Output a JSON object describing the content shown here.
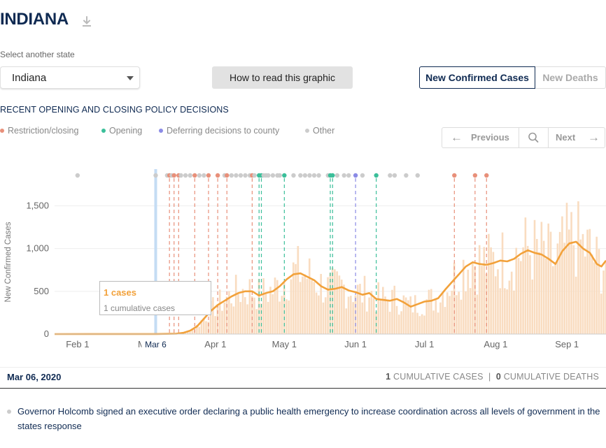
{
  "header": {
    "title": "INDIANA",
    "download_icon": "download-icon"
  },
  "selector": {
    "label": "Select another state",
    "value": "Indiana"
  },
  "buttons": {
    "how_to_read": "How to read this graphic",
    "toggle_cases": "New Confirmed Cases",
    "toggle_deaths": "New Deaths"
  },
  "policy": {
    "heading": "RECENT OPENING AND CLOSING POLICY DECISIONS",
    "legend": [
      {
        "label": "Restriction/closing",
        "color": "#e8907a"
      },
      {
        "label": "Opening",
        "color": "#3bbf9a"
      },
      {
        "label": "Deferring decisions to county",
        "color": "#8b8be6"
      },
      {
        "label": "Other",
        "color": "#cccccc"
      }
    ]
  },
  "nav": {
    "previous": "Previous",
    "next": "Next",
    "search_icon": "search-icon",
    "prev_icon": "arrow-left-icon",
    "next_icon": "arrow-right-icon"
  },
  "colors": {
    "navy": "#0f2a52",
    "line": "#f2a13a",
    "bar": "#f9dcc0",
    "selected": "#c4dcf4"
  },
  "chart_data": {
    "type": "line",
    "ylabel": "New Confirmed Cases",
    "yticks": [
      "0",
      "500",
      "1,000",
      "1,500"
    ],
    "ylim": [
      0,
      1700
    ],
    "xticks": [
      "Feb 1",
      "Ma",
      "Apr 1",
      "May 1",
      "Jun 1",
      "Jul 1",
      "Aug 1",
      "Sep 1"
    ],
    "selected_tick": "Mar 6",
    "x_range": [
      "2020-01-22",
      "2020-09-18"
    ],
    "series": [
      {
        "values_7day_avg": [
          [
            "2020-01-22",
            0
          ],
          [
            "2020-03-06",
            1
          ],
          [
            "2020-03-15",
            5
          ],
          [
            "2020-03-18",
            15
          ],
          [
            "2020-03-21",
            40
          ],
          [
            "2020-03-24",
            90
          ],
          [
            "2020-03-27",
            180
          ],
          [
            "2020-03-30",
            270
          ],
          [
            "2020-04-02",
            340
          ],
          [
            "2020-04-05",
            390
          ],
          [
            "2020-04-08",
            440
          ],
          [
            "2020-04-11",
            480
          ],
          [
            "2020-04-14",
            500
          ],
          [
            "2020-04-17",
            500
          ],
          [
            "2020-04-20",
            450
          ],
          [
            "2020-04-23",
            480
          ],
          [
            "2020-04-26",
            500
          ],
          [
            "2020-04-29",
            560
          ],
          [
            "2020-05-02",
            640
          ],
          [
            "2020-05-05",
            700
          ],
          [
            "2020-05-08",
            710
          ],
          [
            "2020-05-11",
            670
          ],
          [
            "2020-05-14",
            630
          ],
          [
            "2020-05-17",
            560
          ],
          [
            "2020-05-20",
            520
          ],
          [
            "2020-05-23",
            530
          ],
          [
            "2020-05-26",
            550
          ],
          [
            "2020-05-29",
            510
          ],
          [
            "2020-06-01",
            490
          ],
          [
            "2020-06-04",
            460
          ],
          [
            "2020-06-07",
            480
          ],
          [
            "2020-06-10",
            410
          ],
          [
            "2020-06-13",
            400
          ],
          [
            "2020-06-16",
            390
          ],
          [
            "2020-06-19",
            410
          ],
          [
            "2020-06-22",
            370
          ],
          [
            "2020-06-25",
            320
          ],
          [
            "2020-06-28",
            350
          ],
          [
            "2020-07-01",
            380
          ],
          [
            "2020-07-04",
            390
          ],
          [
            "2020-07-07",
            420
          ],
          [
            "2020-07-10",
            520
          ],
          [
            "2020-07-13",
            610
          ],
          [
            "2020-07-16",
            700
          ],
          [
            "2020-07-19",
            790
          ],
          [
            "2020-07-22",
            840
          ],
          [
            "2020-07-25",
            820
          ],
          [
            "2020-07-28",
            810
          ],
          [
            "2020-07-31",
            830
          ],
          [
            "2020-08-03",
            860
          ],
          [
            "2020-08-06",
            850
          ],
          [
            "2020-08-09",
            880
          ],
          [
            "2020-08-12",
            940
          ],
          [
            "2020-08-15",
            980
          ],
          [
            "2020-08-18",
            950
          ],
          [
            "2020-08-21",
            930
          ],
          [
            "2020-08-24",
            880
          ],
          [
            "2020-08-27",
            820
          ],
          [
            "2020-08-30",
            970
          ],
          [
            "2020-09-02",
            1060
          ],
          [
            "2020-09-05",
            1080
          ],
          [
            "2020-09-08",
            1000
          ],
          [
            "2020-09-11",
            950
          ],
          [
            "2020-09-14",
            820
          ],
          [
            "2020-09-16",
            790
          ],
          [
            "2020-09-18",
            860
          ]
        ]
      }
    ],
    "policy_events": [
      {
        "date": "2020-02-01",
        "type": "other"
      },
      {
        "date": "2020-03-06",
        "type": "other"
      },
      {
        "date": "2020-03-11",
        "type": "other"
      },
      {
        "date": "2020-03-12",
        "type": "restriction"
      },
      {
        "date": "2020-03-13",
        "type": "other"
      },
      {
        "date": "2020-03-14",
        "type": "restriction"
      },
      {
        "date": "2020-03-16",
        "type": "restriction"
      },
      {
        "date": "2020-03-17",
        "type": "other"
      },
      {
        "date": "2020-03-19",
        "type": "other"
      },
      {
        "date": "2020-03-21",
        "type": "other"
      },
      {
        "date": "2020-03-23",
        "type": "restriction"
      },
      {
        "date": "2020-03-25",
        "type": "other"
      },
      {
        "date": "2020-03-27",
        "type": "other"
      },
      {
        "date": "2020-03-29",
        "type": "restriction"
      },
      {
        "date": "2020-04-02",
        "type": "restriction"
      },
      {
        "date": "2020-04-05",
        "type": "other"
      },
      {
        "date": "2020-04-06",
        "type": "restriction"
      },
      {
        "date": "2020-04-08",
        "type": "other"
      },
      {
        "date": "2020-04-10",
        "type": "other"
      },
      {
        "date": "2020-04-12",
        "type": "other"
      },
      {
        "date": "2020-04-14",
        "type": "other"
      },
      {
        "date": "2020-04-16",
        "type": "other"
      },
      {
        "date": "2020-04-17",
        "type": "restriction"
      },
      {
        "date": "2020-04-18",
        "type": "other"
      },
      {
        "date": "2020-04-20",
        "type": "opening"
      },
      {
        "date": "2020-04-21",
        "type": "opening"
      },
      {
        "date": "2020-04-22",
        "type": "other"
      },
      {
        "date": "2020-04-23",
        "type": "other"
      },
      {
        "date": "2020-04-24",
        "type": "other"
      },
      {
        "date": "2020-04-26",
        "type": "other"
      },
      {
        "date": "2020-04-28",
        "type": "other"
      },
      {
        "date": "2020-04-29",
        "type": "other"
      },
      {
        "date": "2020-05-01",
        "type": "opening"
      },
      {
        "date": "2020-05-05",
        "type": "other"
      },
      {
        "date": "2020-05-08",
        "type": "other"
      },
      {
        "date": "2020-05-10",
        "type": "other"
      },
      {
        "date": "2020-05-12",
        "type": "other"
      },
      {
        "date": "2020-05-14",
        "type": "other"
      },
      {
        "date": "2020-05-16",
        "type": "other"
      },
      {
        "date": "2020-05-20",
        "type": "other"
      },
      {
        "date": "2020-05-21",
        "type": "opening"
      },
      {
        "date": "2020-05-22",
        "type": "opening"
      },
      {
        "date": "2020-05-24",
        "type": "other"
      },
      {
        "date": "2020-05-27",
        "type": "other"
      },
      {
        "date": "2020-05-29",
        "type": "other"
      },
      {
        "date": "2020-06-01",
        "type": "deferring"
      },
      {
        "date": "2020-06-04",
        "type": "other"
      },
      {
        "date": "2020-06-10",
        "type": "opening"
      },
      {
        "date": "2020-06-16",
        "type": "other"
      },
      {
        "date": "2020-06-18",
        "type": "other"
      },
      {
        "date": "2020-06-23",
        "type": "other"
      },
      {
        "date": "2020-06-28",
        "type": "other"
      },
      {
        "date": "2020-07-14",
        "type": "restriction"
      },
      {
        "date": "2020-07-23",
        "type": "restriction"
      },
      {
        "date": "2020-07-28",
        "type": "restriction"
      }
    ]
  },
  "tooltip": {
    "cases": "1 cases",
    "cumulative": "1 cumulative cases"
  },
  "summary": {
    "date": "Mar 06, 2020",
    "cumulative_cases_value": "1",
    "cumulative_cases_label": "CUMULATIVE CASES",
    "separator": "|",
    "cumulative_deaths_value": "0",
    "cumulative_deaths_label": "CUMULATIVE DEATHS"
  },
  "event": {
    "text": "Governor Holcomb signed an executive order declaring a public health emergency to increase coordination across all levels of government in the states response"
  }
}
